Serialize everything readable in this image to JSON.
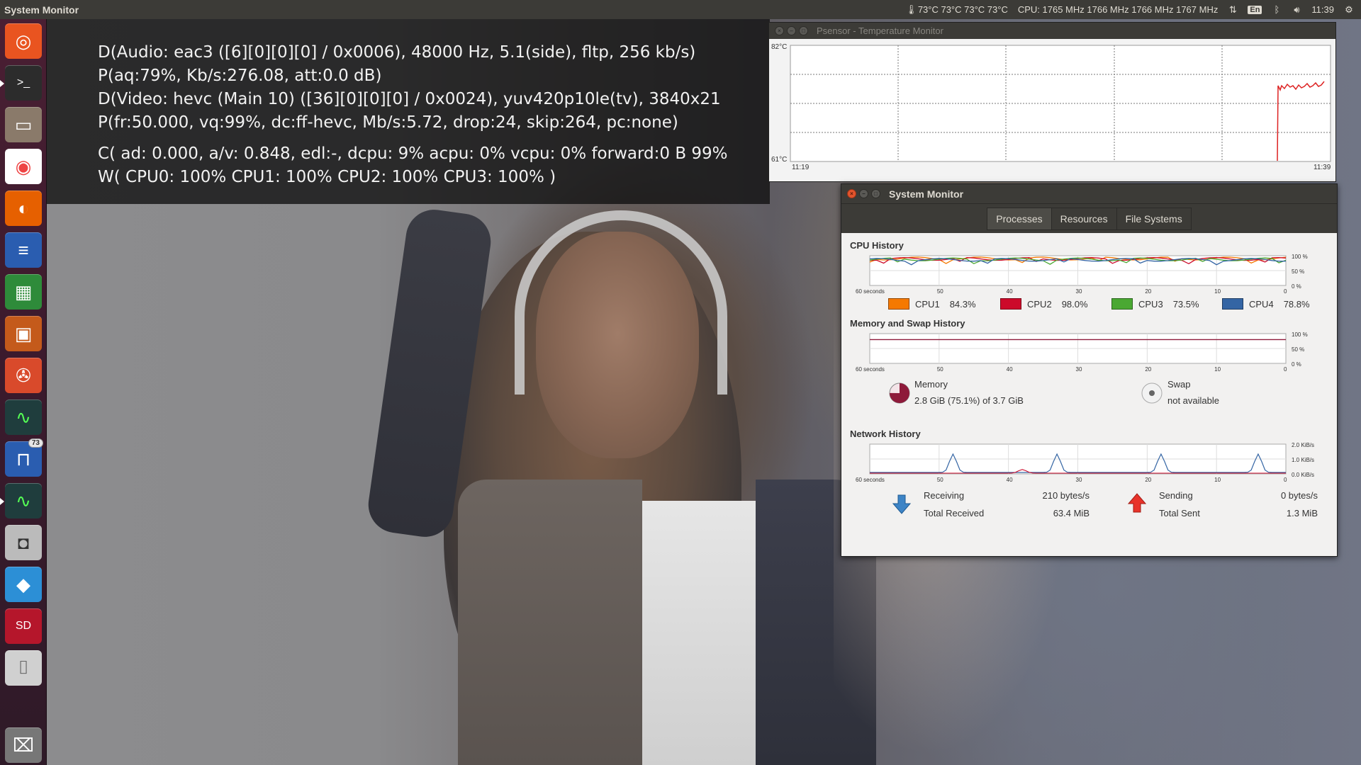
{
  "top_panel": {
    "app_title": "System Monitor",
    "temps": "73°C 73°C 73°C 73°C",
    "cpu_freq": "CPU: 1765 MHz 1766 MHz 1766 MHz 1767 MHz",
    "keyboard_lang": "En",
    "clock": "11:39"
  },
  "launcher": {
    "items": [
      {
        "name": "ubuntu-dash",
        "glyph": "◎"
      },
      {
        "name": "terminal",
        "glyph": ">_"
      },
      {
        "name": "files",
        "glyph": "▭"
      },
      {
        "name": "chrome",
        "glyph": "◉"
      },
      {
        "name": "firefox",
        "glyph": "◐"
      },
      {
        "name": "writer",
        "glyph": "≡"
      },
      {
        "name": "calc",
        "glyph": "▦"
      },
      {
        "name": "impress",
        "glyph": "▣"
      },
      {
        "name": "settings",
        "glyph": "✇"
      },
      {
        "name": "system-monitor",
        "glyph": "∿"
      },
      {
        "name": "psensor",
        "glyph": "⊓",
        "badge": "73"
      },
      {
        "name": "system-monitor-2",
        "glyph": "∿"
      },
      {
        "name": "camera",
        "glyph": "◘"
      },
      {
        "name": "kodi",
        "glyph": "◆"
      },
      {
        "name": "sd-card",
        "glyph": "SD"
      },
      {
        "name": "usb-drive",
        "glyph": "⌷"
      },
      {
        "name": "trash",
        "glyph": "⌧"
      }
    ]
  },
  "osd": {
    "line1": "D(Audio: eac3 ([6][0][0][0] / 0x0006), 48000 Hz, 5.1(side), fltp, 256 kb/s)",
    "line2": "P(aq:79%, Kb/s:276.08, att:0.0 dB)",
    "line3": "D(Video: hevc (Main 10) ([36][0][0][0] / 0x0024), yuv420p10le(tv), 3840x21",
    "line4": "P(fr:50.000, vq:99%, dc:ff-hevc, Mb/s:5.72, drop:24, skip:264, pc:none)",
    "line5": "C( ad: 0.000, a/v: 0.848, edl:-, dcpu: 9% acpu: 0% vcpu: 0% forward:0 B 99%",
    "line6": "W( CPU0: 100% CPU1: 100% CPU2: 100% CPU3: 100% )"
  },
  "psensor": {
    "title": "Psensor - Temperature Monitor",
    "y_max": "82°C",
    "y_min": "61°C",
    "t_start": "11:19",
    "t_end": "11:39"
  },
  "sysmon": {
    "title": "System Monitor",
    "tabs": [
      "Processes",
      "Resources",
      "File Systems"
    ],
    "active_tab": "Processes",
    "cpu": {
      "title": "CPU History",
      "x_labels": [
        "60 seconds",
        "50",
        "40",
        "30",
        "20",
        "10",
        "0"
      ],
      "y_labels": [
        "100 %",
        "50 %",
        "0 %"
      ],
      "legend": [
        {
          "label": "CPU1",
          "value": "84.3%",
          "color": "#f57900"
        },
        {
          "label": "CPU2",
          "value": "98.0%",
          "color": "#cc0a2a"
        },
        {
          "label": "CPU3",
          "value": "73.5%",
          "color": "#4aa832"
        },
        {
          "label": "CPU4",
          "value": "78.8%",
          "color": "#3465a4"
        }
      ]
    },
    "memory": {
      "title": "Memory and Swap History",
      "x_labels": [
        "60 seconds",
        "50",
        "40",
        "30",
        "20",
        "10",
        "0"
      ],
      "y_labels": [
        "100 %",
        "50 %",
        "0 %"
      ],
      "mem_label": "Memory",
      "mem_value": "2.8 GiB (75.1%) of 3.7 GiB",
      "swap_label": "Swap",
      "swap_value": "not available",
      "mem_color": "#8e1a3a"
    },
    "network": {
      "title": "Network History",
      "x_labels": [
        "60 seconds",
        "50",
        "40",
        "30",
        "20",
        "10",
        "0"
      ],
      "y_labels": [
        "2.0 KiB/s",
        "1.0 KiB/s",
        "0.0 KiB/s"
      ],
      "receiving_label": "Receiving",
      "receiving_value": "210 bytes/s",
      "total_received_label": "Total Received",
      "total_received_value": "63.4 MiB",
      "sending_label": "Sending",
      "sending_value": "0 bytes/s",
      "total_sent_label": "Total Sent",
      "total_sent_value": "1.3 MiB"
    }
  }
}
